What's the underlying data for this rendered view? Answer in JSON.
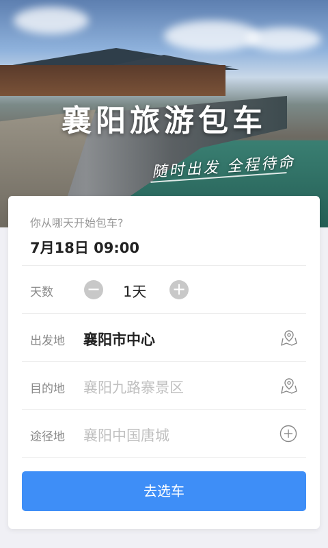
{
  "hero": {
    "title": "襄阳旅游包车",
    "slogan": "随时出发 全程待命"
  },
  "form": {
    "date_question": "你从哪天开始包车?",
    "date_value": "7月18日 09:00",
    "days": {
      "label": "天数",
      "value": "1天",
      "minus": "−",
      "plus": "+"
    },
    "departure": {
      "label": "出发地",
      "value": "襄阳市中心",
      "icon": "map-location-icon"
    },
    "destination": {
      "label": "目的地",
      "placeholder": "襄阳九路寨景区",
      "icon": "map-location-icon"
    },
    "via": {
      "label": "途径地",
      "placeholder": "襄阳中国唐城",
      "icon": "add-circle-icon"
    },
    "submit_label": "去选车"
  },
  "colors": {
    "accent": "#3e8ef7",
    "text_primary": "#222222",
    "text_secondary": "#888888",
    "placeholder": "#c0c0c0",
    "page_bg": "#f0f0f5"
  }
}
